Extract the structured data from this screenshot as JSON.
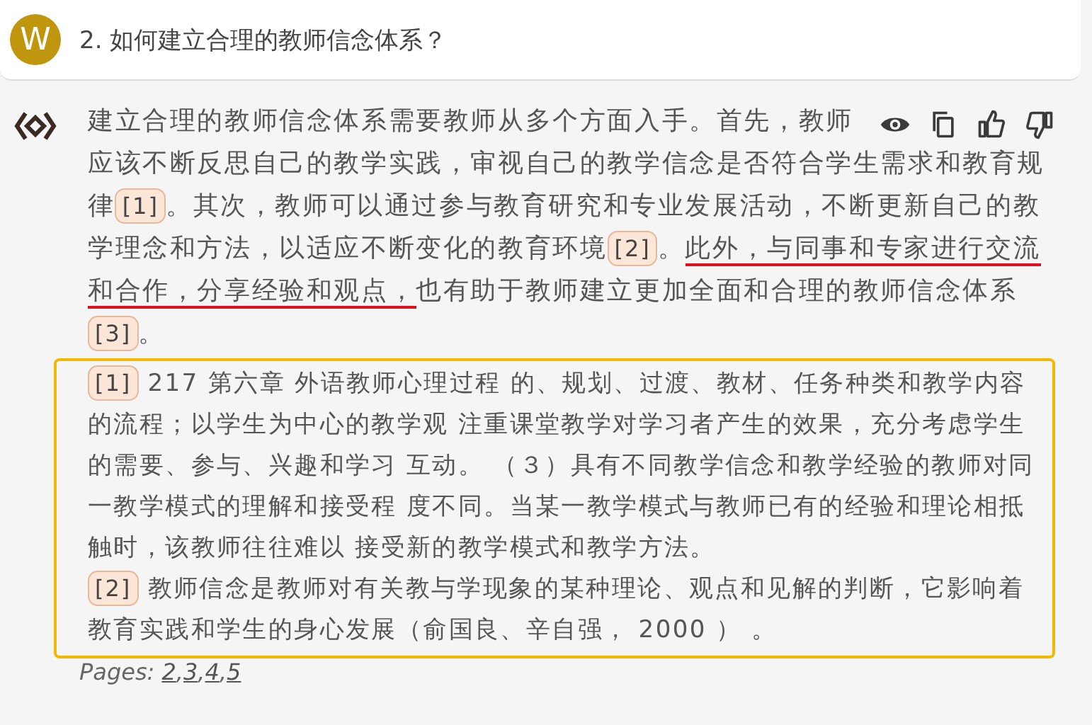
{
  "question": {
    "avatar": "W",
    "text": "2. 如何建立合理的教师信念体系？"
  },
  "answer": {
    "segments": [
      {
        "kind": "text",
        "text": "建立合理的教师信念体系需要教师从多个方面入手。首先，教师应该不断反思自己的教学实践，审视自己的教学信念是否符合学生需求和教育规律",
        "underlined": false
      },
      {
        "kind": "cite",
        "text": "[1]"
      },
      {
        "kind": "text",
        "text": "。其次，教师可以通过参与教育研究和专业发展活动，不断更新自己的教学理念和方法，以适应不断变化的教育环境",
        "underlined": false
      },
      {
        "kind": "cite",
        "text": "[2]"
      },
      {
        "kind": "text",
        "text": "。",
        "underlined": false
      },
      {
        "kind": "text",
        "text": "此外，与同事和专家进行交流和合作，分享经验和观点，",
        "underlined": true
      },
      {
        "kind": "text",
        "text": "也有助于教师建立更加全面和合理的教师信念体系",
        "underlined": false
      },
      {
        "kind": "cite",
        "text": "[3]"
      },
      {
        "kind": "text",
        "text": "。",
        "underlined": false
      }
    ]
  },
  "references": [
    {
      "cite": "[1]",
      "text": "217 第六章 外语教师心理过程 的、规划、过渡、教材、任务种类和教学内容的流程；以学生为中心的教学观 注重课堂教学对学习者产生的效果，充分考虑学生的需要、参与、兴趣和学习 互动。 （３）具有不同教学信念和教学经验的教师对同一教学模式的理解和接受程 度不同。当某一教学模式与教师已有的经验和理论相抵触时，该教师往往难以 接受新的教学模式和教学方法。"
    },
    {
      "cite": "[2]",
      "text": "教师信念是教师对有关教与学现象的某种理论、观点和见解的判断，它影响着教育实践和学生的身心发展（俞国良、辛自强， 2000 ） 。"
    }
  ],
  "pages": {
    "label": "Pages:",
    "separator": ",",
    "links": [
      "2",
      "3",
      "4",
      "5"
    ]
  }
}
